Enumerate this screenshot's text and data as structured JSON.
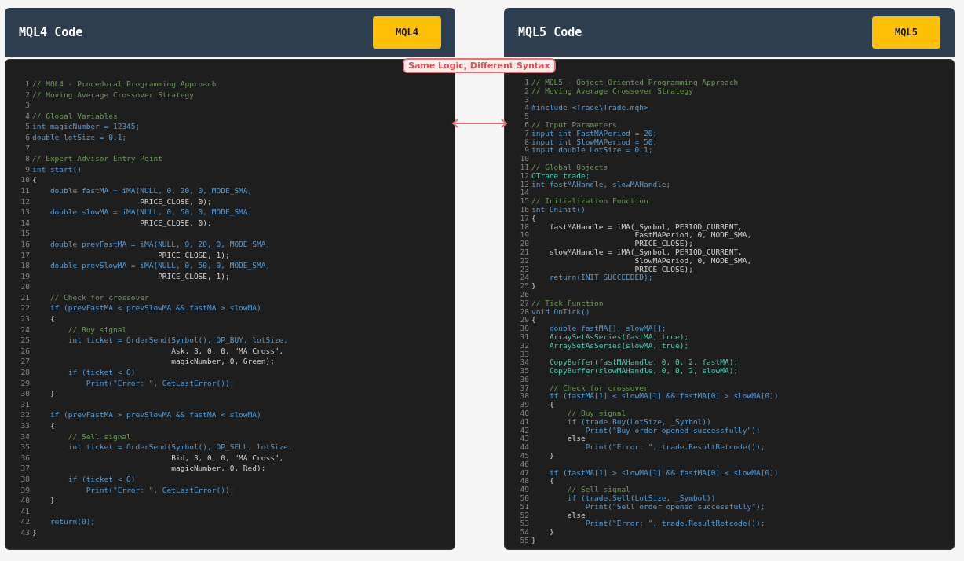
{
  "panels": [
    {
      "title": "MQL4 Code",
      "badge": "MQL4",
      "lines": [
        {
          "n": "1",
          "kind": "comment",
          "text": "// MQL4 - Procedural Programming Approach"
        },
        {
          "n": "2",
          "kind": "comment",
          "text": "// Moving Average Crossover Strategy"
        },
        {
          "n": "3"
        },
        {
          "n": "4",
          "kind": "comment",
          "text": "// Global Variables"
        },
        {
          "n": "5",
          "kind": "code",
          "text": "int magicNumber = 12345;"
        },
        {
          "n": "6",
          "kind": "code",
          "text": "double lotSize = 0.1;"
        },
        {
          "n": "7"
        },
        {
          "n": "8",
          "kind": "comment",
          "text": "// Expert Advisor Entry Point"
        },
        {
          "n": "9",
          "kind": "code",
          "text": "int start()"
        },
        {
          "n": "10",
          "kind": "plain",
          "text": "{"
        },
        {
          "n": "11",
          "kind": "code",
          "text": "    double fastMA = iMA(NULL, 0, 20, 0, MODE_SMA,"
        },
        {
          "n": "12",
          "kind": "plain",
          "text": "                        PRICE_CLOSE, 0);"
        },
        {
          "n": "13",
          "kind": "code",
          "text": "    double slowMA = iMA(NULL, 0, 50, 0, MODE_SMA,"
        },
        {
          "n": "14",
          "kind": "plain",
          "text": "                        PRICE_CLOSE, 0);"
        },
        {
          "n": "15"
        },
        {
          "n": "16",
          "kind": "code",
          "text": "    double prevFastMA = iMA(NULL, 0, 20, 0, MODE_SMA,"
        },
        {
          "n": "17",
          "kind": "plain",
          "text": "                            PRICE_CLOSE, 1);"
        },
        {
          "n": "18",
          "kind": "code",
          "text": "    double prevSlowMA = iMA(NULL, 0, 50, 0, MODE_SMA,"
        },
        {
          "n": "19",
          "kind": "plain",
          "text": "                            PRICE_CLOSE, 1);"
        },
        {
          "n": "20"
        },
        {
          "n": "21",
          "kind": "comment",
          "text": "    // Check for crossover"
        },
        {
          "n": "22",
          "kind": "code",
          "text": "    if (prevFastMA < prevSlowMA && fastMA > slowMA)"
        },
        {
          "n": "23",
          "kind": "plain",
          "text": "    {"
        },
        {
          "n": "24",
          "kind": "comment",
          "text": "        // Buy signal"
        },
        {
          "n": "25",
          "kind": "code",
          "text": "        int ticket = OrderSend(Symbol(), OP_BUY, lotSize,"
        },
        {
          "n": "26",
          "kind": "plain",
          "text": "                               Ask, 3, 0, 0, \"MA Cross\","
        },
        {
          "n": "27",
          "kind": "plain",
          "text": "                               magicNumber, 0, Green);"
        },
        {
          "n": "28",
          "kind": "code",
          "text": "        if (ticket < 0)"
        },
        {
          "n": "29",
          "kind": "code",
          "text": "            Print(\"Error: \", GetLastError());"
        },
        {
          "n": "30",
          "kind": "plain",
          "text": "    }"
        },
        {
          "n": "31"
        },
        {
          "n": "32",
          "kind": "code",
          "text": "    if (prevFastMA > prevSlowMA && fastMA < slowMA)"
        },
        {
          "n": "33",
          "kind": "plain",
          "text": "    {"
        },
        {
          "n": "34",
          "kind": "comment",
          "text": "        // Sell signal"
        },
        {
          "n": "35",
          "kind": "code",
          "text": "        int ticket = OrderSend(Symbol(), OP_SELL, lotSize,"
        },
        {
          "n": "36",
          "kind": "plain",
          "text": "                               Bid, 3, 0, 0, \"MA Cross\","
        },
        {
          "n": "37",
          "kind": "plain",
          "text": "                               magicNumber, 0, Red);"
        },
        {
          "n": "38",
          "kind": "code",
          "text": "        if (ticket < 0)"
        },
        {
          "n": "39",
          "kind": "code",
          "text": "            Print(\"Error: \", GetLastError());"
        },
        {
          "n": "40",
          "kind": "plain",
          "text": "    }"
        },
        {
          "n": "41"
        },
        {
          "n": "42",
          "kind": "code",
          "text": "    return(0);"
        },
        {
          "n": "43",
          "kind": "plain",
          "text": "}"
        }
      ]
    },
    {
      "title": "MQL5 Code",
      "badge": "MQL5",
      "lines": [
        {
          "n": "1",
          "kind": "comment",
          "text": "// MQL5 - Object-Oriented Programming Approach"
        },
        {
          "n": "2",
          "kind": "comment",
          "text": "// Moving Average Crossover Strategy"
        },
        {
          "n": "3"
        },
        {
          "n": "4",
          "kind": "code",
          "text": "#include <Trade\\Trade.mqh>"
        },
        {
          "n": "5"
        },
        {
          "n": "6",
          "kind": "comment",
          "text": "// Input Parameters"
        },
        {
          "n": "7",
          "kind": "code",
          "text": "input int FastMAPeriod = 20;"
        },
        {
          "n": "8",
          "kind": "code",
          "text": "input int SlowMAPeriod = 50;"
        },
        {
          "n": "9",
          "kind": "code",
          "text": "input double LotSize = 0.1;"
        },
        {
          "n": "10"
        },
        {
          "n": "11",
          "kind": "comment",
          "text": "// Global Objects"
        },
        {
          "n": "12",
          "kind": "type",
          "text": "CTrade trade;"
        },
        {
          "n": "13",
          "kind": "code",
          "text": "int fastMAHandle, slowMAHandle;"
        },
        {
          "n": "14"
        },
        {
          "n": "15",
          "kind": "comment",
          "text": "// Initialization Function"
        },
        {
          "n": "16",
          "kind": "code",
          "text": "int OnInit()"
        },
        {
          "n": "17",
          "kind": "plain",
          "text": "{"
        },
        {
          "n": "18",
          "kind": "plain",
          "text": "    fastMAHandle = iMA(_Symbol, PERIOD_CURRENT,"
        },
        {
          "n": "19",
          "kind": "plain",
          "text": "                       FastMAPeriod, 0, MODE_SMA,"
        },
        {
          "n": "20",
          "kind": "plain",
          "text": "                       PRICE_CLOSE);"
        },
        {
          "n": "21",
          "kind": "plain",
          "text": "    slowMAHandle = iMA(_Symbol, PERIOD_CURRENT,"
        },
        {
          "n": "22",
          "kind": "plain",
          "text": "                       SlowMAPeriod, 0, MODE_SMA,"
        },
        {
          "n": "23",
          "kind": "plain",
          "text": "                       PRICE_CLOSE);"
        },
        {
          "n": "24",
          "kind": "code",
          "text": "    return(INIT_SUCCEEDED);"
        },
        {
          "n": "25",
          "kind": "plain",
          "text": "}"
        },
        {
          "n": "26"
        },
        {
          "n": "27",
          "kind": "comment",
          "text": "// Tick Function"
        },
        {
          "n": "28",
          "kind": "code",
          "text": "void OnTick()"
        },
        {
          "n": "29",
          "kind": "plain",
          "text": "{"
        },
        {
          "n": "30",
          "kind": "code",
          "text": "    double fastMA[], slowMA[];"
        },
        {
          "n": "31",
          "kind": "type",
          "text": "    ArraySetAsSeries(fastMA, true);"
        },
        {
          "n": "32",
          "kind": "type",
          "text": "    ArraySetAsSeries(slowMA, true);"
        },
        {
          "n": "33"
        },
        {
          "n": "34",
          "kind": "type",
          "text": "    CopyBuffer(fastMAHandle, 0, 0, 2, fastMA);"
        },
        {
          "n": "35",
          "kind": "type",
          "text": "    CopyBuffer(slowMAHandle, 0, 0, 2, slowMA);"
        },
        {
          "n": "36"
        },
        {
          "n": "37",
          "kind": "comment",
          "text": "    // Check for crossover"
        },
        {
          "n": "38",
          "kind": "code",
          "text": "    if (fastMA[1] < slowMA[1] && fastMA[0] > slowMA[0])"
        },
        {
          "n": "39",
          "kind": "plain",
          "text": "    {"
        },
        {
          "n": "40",
          "kind": "comment",
          "text": "        // Buy signal"
        },
        {
          "n": "41",
          "kind": "code",
          "text": "        if (trade.Buy(LotSize, _Symbol))"
        },
        {
          "n": "42",
          "kind": "code",
          "text": "            Print(\"Buy order opened successfully\");"
        },
        {
          "n": "43",
          "kind": "plain",
          "text": "        else"
        },
        {
          "n": "44",
          "kind": "code",
          "text": "            Print(\"Error: \", trade.ResultRetcode());"
        },
        {
          "n": "45",
          "kind": "plain",
          "text": "    }"
        },
        {
          "n": "46"
        },
        {
          "n": "47",
          "kind": "code",
          "text": "    if (fastMA[1] > slowMA[1] && fastMA[0] < slowMA[0])"
        },
        {
          "n": "48",
          "kind": "plain",
          "text": "    {"
        },
        {
          "n": "49",
          "kind": "comment",
          "text": "        // Sell signal"
        },
        {
          "n": "50",
          "kind": "code",
          "text": "        if (trade.Sell(LotSize, _Symbol))"
        },
        {
          "n": "51",
          "kind": "code",
          "text": "            Print(\"Sell order opened successfully\");"
        },
        {
          "n": "52",
          "kind": "plain",
          "text": "        else"
        },
        {
          "n": "53",
          "kind": "code",
          "text": "            Print(\"Error: \", trade.ResultRetcode());"
        },
        {
          "n": "54",
          "kind": "plain",
          "text": "    }"
        },
        {
          "n": "55",
          "kind": "plain",
          "text": "}"
        }
      ]
    }
  ],
  "connector": {
    "label": "Same Logic, Different Syntax"
  }
}
